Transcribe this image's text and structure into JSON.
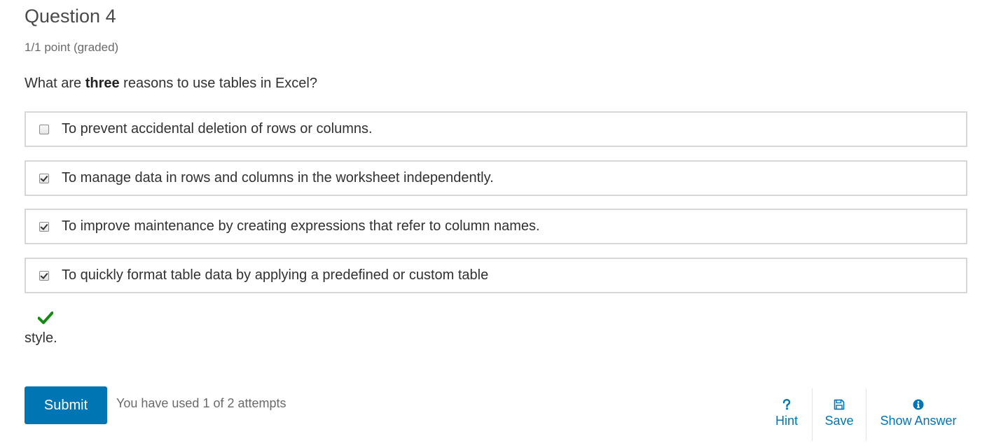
{
  "question": {
    "title": "Question 4",
    "score": "1/1 point (graded)",
    "prompt_before": "What are ",
    "prompt_bold": "three",
    "prompt_after": " reasons to use tables in Excel?"
  },
  "choices": [
    {
      "label": "To prevent accidental deletion of rows or columns.",
      "checked": false
    },
    {
      "label": "To manage data in rows and columns in the worksheet independently.",
      "checked": true
    },
    {
      "label": "To improve maintenance by creating expressions that refer to column names.",
      "checked": true
    },
    {
      "label": "To quickly format table data by applying a predefined or custom table",
      "checked": true
    }
  ],
  "overflow_text": "style.",
  "status": {
    "icon": "checkmark-icon",
    "color": "#138b13"
  },
  "actions": {
    "submit_label": "Submit",
    "attempts_text": "You have used 1 of 2 attempts",
    "hint_label": "Hint",
    "save_label": "Save",
    "show_answer_label": "Show Answer"
  },
  "colors": {
    "accent": "#0075b4",
    "correct": "#138b13",
    "border": "#d7d7d7"
  }
}
